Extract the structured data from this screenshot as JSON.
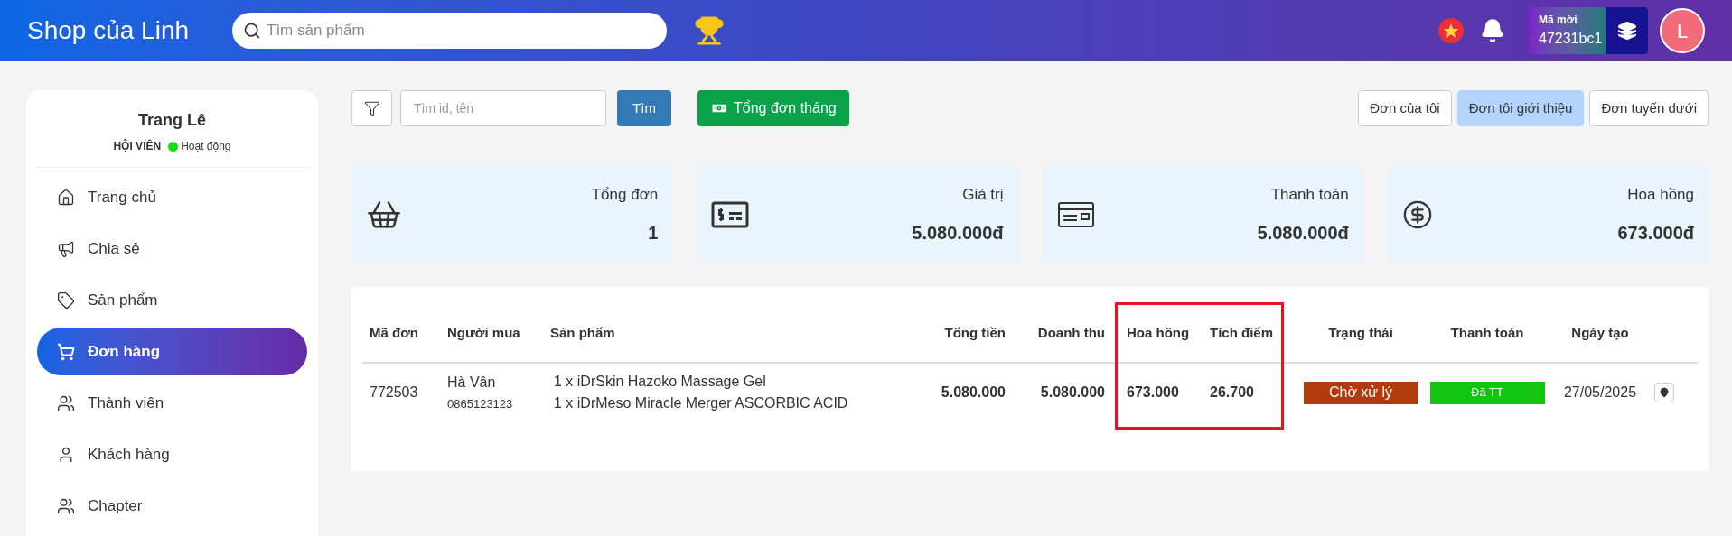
{
  "header": {
    "title": "Shop của Linh",
    "search": {
      "placeholder": "Tìm sản phẩm"
    },
    "invite": {
      "label": "Mã mời",
      "code": "47231bc1"
    },
    "avatar": "L"
  },
  "profile": {
    "name": "Trang Lê",
    "role": "HỘI VIÊN",
    "status": "Hoạt động",
    "online": true
  },
  "sidebar": {
    "items": [
      {
        "label": "Trang chủ",
        "kind": "home",
        "selected": false
      },
      {
        "label": "Chia sẻ",
        "kind": "share",
        "selected": false
      },
      {
        "label": "Sản phẩm",
        "kind": "tag",
        "selected": false
      },
      {
        "label": "Đơn hàng",
        "kind": "cart",
        "selected": true
      },
      {
        "label": "Thành viên",
        "kind": "users",
        "selected": false
      },
      {
        "label": "Khách hàng",
        "kind": "user",
        "selected": false
      },
      {
        "label": "Chapter",
        "kind": "users",
        "selected": false
      }
    ]
  },
  "toolbar": {
    "search": {
      "placeholder": "Tìm id, tên"
    },
    "search_button": "Tìm",
    "monthly_button": "Tổng đơn tháng",
    "tabs": [
      {
        "label": "Đơn của tôi",
        "selected": false
      },
      {
        "label": "Đơn tôi giới thiệu",
        "selected": true
      },
      {
        "label": "Đơn tuyến dưới",
        "selected": false
      }
    ]
  },
  "stats": [
    {
      "title": "Tổng đơn",
      "value": "1",
      "kind": "basket"
    },
    {
      "title": "Giá trị",
      "value": "5.080.000đ",
      "kind": "bill"
    },
    {
      "title": "Thanh toán",
      "value": "5.080.000đ",
      "kind": "cheque"
    },
    {
      "title": "Hoa hồng",
      "value": "673.000đ",
      "kind": "dollar"
    }
  ],
  "table": {
    "columns": [
      "Mã đơn",
      "Người mua",
      "Sản phẩm",
      "Tổng tiền",
      "Doanh thu",
      "Hoa hồng",
      "Tích điểm",
      "Trạng thái",
      "Thanh toán",
      "Ngày tạo"
    ],
    "rows": [
      {
        "id": "772503",
        "buyer": "Hà Vân",
        "phone": "0865123123",
        "products": [
          "1 x iDrSkin Hazoko Massage Gel",
          "1 x iDrMeso Miracle Merger ASCORBIC ACID"
        ],
        "total": "5.080.000",
        "revenue": "5.080.000",
        "commission": "673.000",
        "points": "26.700",
        "status": {
          "label": "Chờ xử lý",
          "color": "#b23a0c"
        },
        "payment": {
          "label": "Đã TT",
          "color": "#11c511"
        },
        "date": "27/05/2025"
      }
    ]
  }
}
